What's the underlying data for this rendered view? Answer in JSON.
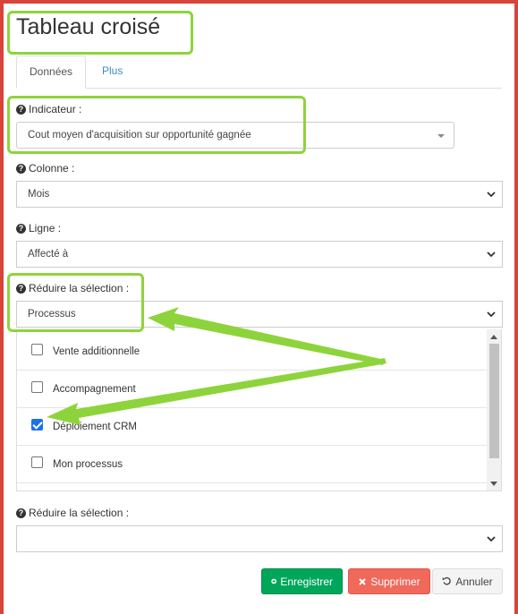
{
  "title": "Tableau croisé",
  "tabs": [
    {
      "label": "Données",
      "active": true
    },
    {
      "label": "Plus",
      "active": false
    }
  ],
  "fields": {
    "indicator": {
      "label": "Indicateur :",
      "value": "Cout moyen d'acquisition sur opportunité gagnée"
    },
    "column": {
      "label": "Colonne :",
      "value": "Mois"
    },
    "row": {
      "label": "Ligne :",
      "value": "Affecté à"
    },
    "reduce1": {
      "label": "Réduire la sélection :",
      "value": "Processus"
    },
    "reduce2": {
      "label": "Réduire la sélection :",
      "value": ""
    }
  },
  "options": [
    {
      "label": "Vente additionnelle",
      "checked": false
    },
    {
      "label": "Accompagnement",
      "checked": false
    },
    {
      "label": "Déploiement CRM",
      "checked": true
    },
    {
      "label": "Mon processus",
      "checked": false
    }
  ],
  "buttons": {
    "save": "Enregistrer",
    "delete": "Supprimer",
    "cancel": "Annuler"
  },
  "colors": {
    "highlight": "#8dd43c",
    "save": "#00a65a",
    "delete": "#f0695a",
    "link": "#3c8dbc",
    "frame": "#d8433a"
  }
}
